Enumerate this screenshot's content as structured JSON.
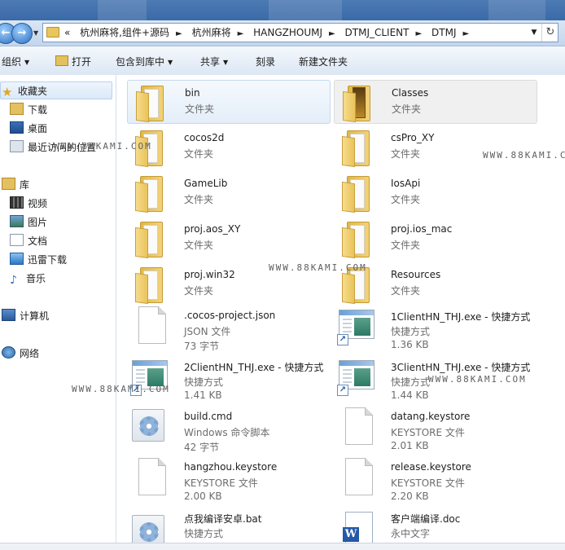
{
  "address": {
    "crumbs": [
      "«",
      "杭州麻将,组件+源码",
      "杭州麻将",
      "HANGZHOUMJ",
      "DTMJ_CLIENT",
      "DTMJ"
    ]
  },
  "toolbar": {
    "organize": "组织",
    "open": "打开",
    "include_in_library": "包含到库中",
    "share": "共享",
    "burn": "刻录",
    "new_folder": "新建文件夹"
  },
  "sidebar": {
    "favorites": "收藏夹",
    "downloads": "下载",
    "desktop": "桌面",
    "recent": "最近访问的位置",
    "libraries": "库",
    "videos": "视频",
    "pictures": "图片",
    "documents": "文档",
    "thunder": "迅雷下载",
    "music": "音乐",
    "computer": "计算机",
    "network": "网络"
  },
  "files": [
    {
      "name": "bin",
      "type": "文件夹",
      "size": "",
      "icon": "folder-icon"
    },
    {
      "name": "Classes",
      "type": "文件夹",
      "size": "",
      "icon": "folder-icon"
    },
    {
      "name": "cocos2d",
      "type": "文件夹",
      "size": "",
      "icon": "folder-icon"
    },
    {
      "name": "csPro_XY",
      "type": "文件夹",
      "size": "",
      "icon": "folder-icon"
    },
    {
      "name": "GameLib",
      "type": "文件夹",
      "size": "",
      "icon": "folder-icon"
    },
    {
      "name": "IosApi",
      "type": "文件夹",
      "size": "",
      "icon": "folder-icon"
    },
    {
      "name": "proj.aos_XY",
      "type": "文件夹",
      "size": "",
      "icon": "folder-icon"
    },
    {
      "name": "proj.ios_mac",
      "type": "文件夹",
      "size": "",
      "icon": "folder-icon"
    },
    {
      "name": "proj.win32",
      "type": "文件夹",
      "size": "",
      "icon": "folder-icon"
    },
    {
      "name": "Resources",
      "type": "文件夹",
      "size": "",
      "icon": "folder-icon"
    },
    {
      "name": ".cocos-project.json",
      "type": "JSON 文件",
      "size": "73 字节",
      "icon": "file-icon"
    },
    {
      "name": "1ClientHN_THJ.exe - 快捷方式",
      "type": "快捷方式",
      "size": "1.36 KB",
      "icon": "shortcut-icon"
    },
    {
      "name": "2ClientHN_THJ.exe - 快捷方式",
      "type": "快捷方式",
      "size": "1.41 KB",
      "icon": "shortcut-icon"
    },
    {
      "name": "3ClientHN_THJ.exe - 快捷方式",
      "type": "快捷方式",
      "size": "1.44 KB",
      "icon": "shortcut-icon"
    },
    {
      "name": "build.cmd",
      "type": "Windows 命令脚本",
      "size": "42 字节",
      "icon": "script-icon"
    },
    {
      "name": "datang.keystore",
      "type": "KEYSTORE 文件",
      "size": "2.01 KB",
      "icon": "file-icon"
    },
    {
      "name": "hangzhou.keystore",
      "type": "KEYSTORE 文件",
      "size": "2.00 KB",
      "icon": "file-icon"
    },
    {
      "name": "release.keystore",
      "type": "KEYSTORE 文件",
      "size": "2.20 KB",
      "icon": "file-icon"
    },
    {
      "name": "点我编译安卓.bat",
      "type": "快捷方式",
      "size": "",
      "icon": "script-icon"
    },
    {
      "name": "客户端编译.doc",
      "type": "永中文字",
      "size": "",
      "icon": "word-doc-icon"
    }
  ],
  "watermark": "WWW.88KAMI.COM",
  "colors": {
    "folder": "#e9c35b",
    "selection": "#dbe9f8",
    "titlebar": "#3a6aa8"
  }
}
